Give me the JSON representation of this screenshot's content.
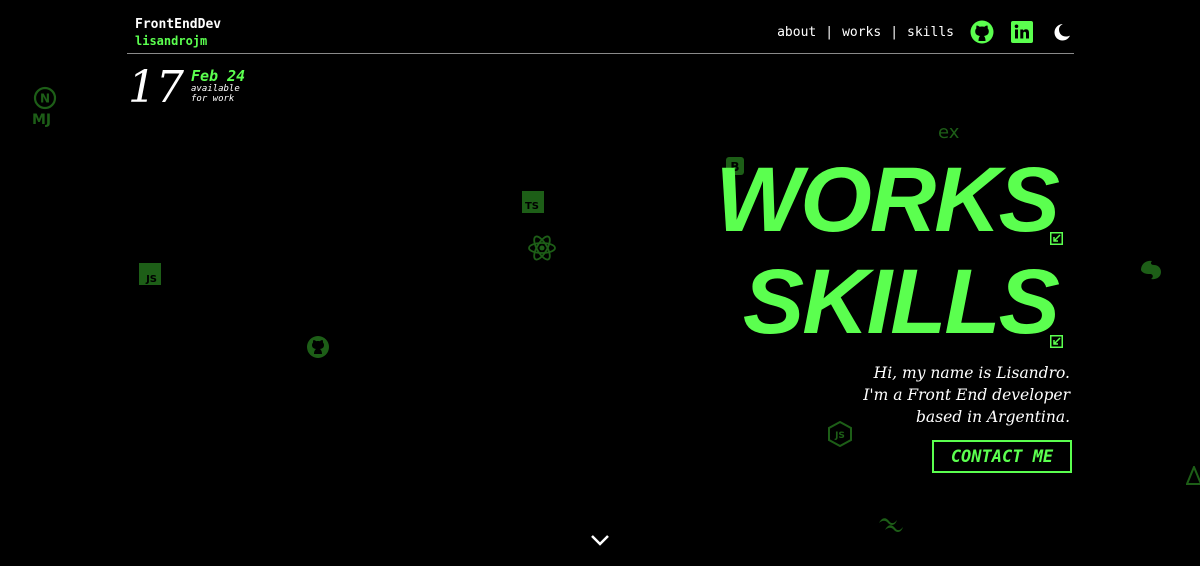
{
  "header": {
    "brand_name": "FrontEndDev",
    "brand_handle": "lisandrojm",
    "nav": [
      {
        "label": "about"
      },
      {
        "label": "works"
      },
      {
        "label": "skills"
      }
    ],
    "separator": "|",
    "icons": [
      "github-icon",
      "linkedin-icon",
      "moon-icon"
    ]
  },
  "date_block": {
    "day": "17",
    "month": "Feb 24",
    "status": "available\nfor work"
  },
  "hero": {
    "word_1": "WORKS",
    "word_2": "SKILLS",
    "intro_lines": [
      "Hi, my name is Lisandro.",
      "I'm a Front End developer",
      "based in Argentina."
    ],
    "cta_label": "CONTACT ME"
  },
  "background_icons": [
    "nextjs-icon",
    "mui-icon",
    "express-icon",
    "bootstrap-icon",
    "typescript-icon",
    "react-icon",
    "javascript-icon",
    "github-icon",
    "nestjs-icon",
    "nodejs-icon",
    "tailwind-icon",
    "vite-icon"
  ],
  "colors": {
    "background": "#000000",
    "accent": "#5bff4f",
    "text": "#ffffff",
    "muted_icon": "#1d5e17",
    "divider": "#8a8a8a"
  }
}
